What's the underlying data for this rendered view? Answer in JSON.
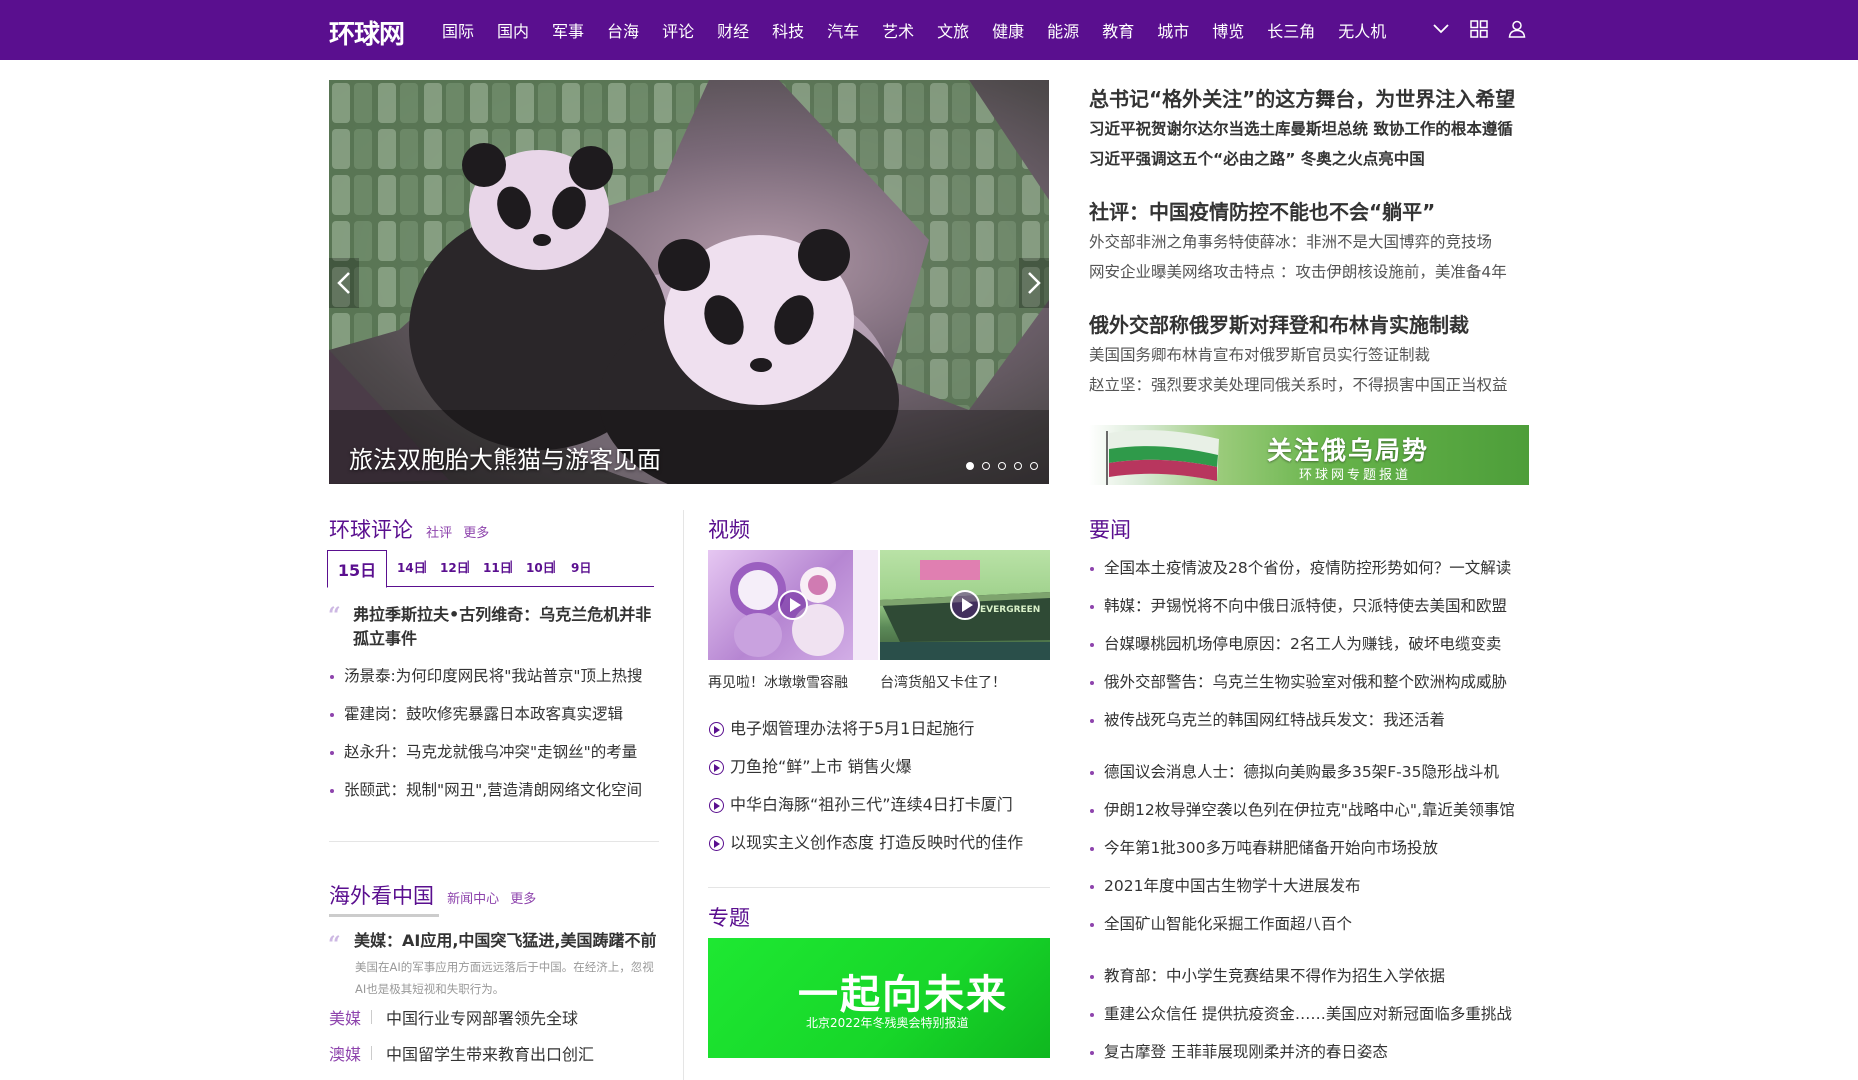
{
  "header": {
    "logo": "环球网",
    "nav": [
      "国际",
      "国内",
      "军事",
      "台海",
      "评论",
      "财经",
      "科技",
      "汽车",
      "艺术",
      "文旅",
      "健康",
      "能源",
      "教育",
      "城市",
      "博览",
      "长三角",
      "无人机"
    ],
    "icons": [
      "chevron-down-icon",
      "grid-icon",
      "user-icon"
    ]
  },
  "carousel": {
    "caption": "旅法双胞胎大熊猫与游客见面",
    "dots": 5,
    "active_dot": 0
  },
  "headlines": [
    {
      "main": "总书记“格外关注”的这方舞台，为世界注入希望",
      "subs": [
        "习近平祝贺谢尔达尔当选土库曼斯坦总统 致协工作的根本遵循",
        "习近平强调这五个“必由之路” 冬奥之火点亮中国"
      ]
    },
    {
      "main": "社评：中国疫情防控不能也不会“躺平”",
      "subs": [
        "外交部非洲之角事务特使薛冰：非洲不是大国博弈的竞技场",
        "网安企业曝美网络攻击特点 ：攻击伊朗核设施前，美准备4年"
      ]
    },
    {
      "main": "俄外交部称俄罗斯对拜登和布林肯实施制裁",
      "subs": [
        "美国国务卿布林肯宣布对俄罗斯官员实行签证制裁",
        "赵立坚：强烈要求美处理同俄关系时，不得损害中国正当权益"
      ]
    }
  ],
  "banner": {
    "title": "关注俄乌局势",
    "sub": "环球网专题报道"
  },
  "commentary": {
    "title": "环球评论",
    "links": [
      "社评",
      "更多"
    ],
    "dates": [
      "15日",
      "14日",
      "12日",
      "11日",
      "10日",
      "9日"
    ],
    "featured": "弗拉季斯拉夫•古列维奇：乌克兰危机并非孤立事件",
    "items": [
      "汤景泰:为何印度网民将\"我站普京\"顶上热搜",
      "霍建岗：鼓吹修宪暴露日本政客真实逻辑",
      "赵永升：马克龙就俄乌冲突\"走钢丝\"的考量",
      "张颐武：规制\"网丑\",营造清朗网络文化空间"
    ]
  },
  "overseas": {
    "title": "海外看中国",
    "links": [
      "新闻中心",
      "更多"
    ],
    "featured": "美媒：AI应用,中国突飞猛进,美国踌躇不前",
    "summary": "美国在AI的军事应用方面远远落后于中国。在经济上，忽视AI也是极其短视和失职行为。",
    "rows": [
      {
        "label": "美媒",
        "text": "中国行业专网部署领先全球"
      },
      {
        "label": "澳媒",
        "text": "中国留学生带来教育出口创汇"
      }
    ]
  },
  "video": {
    "title": "视频",
    "thumbs": [
      {
        "caption": "再见啦！冰墩墩雪容融"
      },
      {
        "caption": "台湾货船又卡住了！",
        "ship_text": "EVERGREEN"
      }
    ],
    "items": [
      "电子烟管理办法将于5月1日起施行",
      "刀鱼抢“鲜”上市 销售火爆",
      "中华白海豚“祖孙三代”连续4日打卡厦门",
      "以现实主义创作态度 打造反映时代的佳作"
    ]
  },
  "special": {
    "title": "专题",
    "banner_title": "一起向未来",
    "banner_sub": "北京2022年冬残奥会特别报道"
  },
  "news": {
    "title": "要闻",
    "groups": [
      [
        "全国本土疫情波及28个省份，疫情防控形势如何？一文解读",
        "韩媒：尹锡悦将不向中俄日派特使，只派特使去美国和欧盟",
        "台媒曝桃园机场停电原因：2名工人为赚钱，破坏电缆变卖",
        "俄外交部警告：乌克兰生物实验室对俄和整个欧洲构成威胁",
        "被传战死乌克兰的韩国网红特战兵发文：我还活着"
      ],
      [
        "德国议会消息人士：德拟向美购最多35架F-35隐形战斗机",
        "伊朗12枚导弹空袭以色列在伊拉克\"战略中心\",靠近美领事馆",
        "今年第1批300多万吨春耕肥储备开始向市场投放",
        "2021年度中国古生物学十大进展发布",
        "全国矿山智能化采掘工作面超八百个"
      ],
      [
        "教育部：中小学生竞赛结果不得作为招生入学依据",
        "重建公众信任 提供抗疫资金……美国应对新冠面临多重挑战",
        "复古摩登 王菲菲展现刚柔并济的春日姿态"
      ]
    ]
  },
  "colors": {
    "brand": "#5a0f8f",
    "accent": "#8e44ad"
  }
}
